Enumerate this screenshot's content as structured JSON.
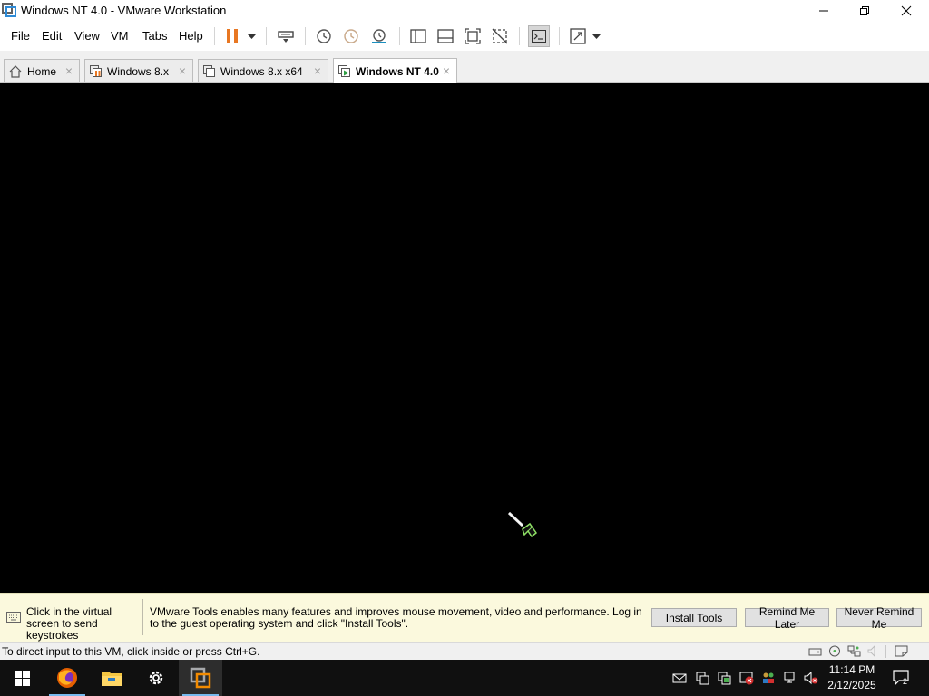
{
  "window": {
    "title": "Windows NT 4.0 - VMware Workstation"
  },
  "menu": [
    "File",
    "Edit",
    "View",
    "VM",
    "Tabs",
    "Help"
  ],
  "toolbar": {
    "icons": [
      "pause-icon",
      "dropdown-arrow-icon",
      "send-ctrl-alt-del-icon",
      "take-snapshot-icon",
      "revert-snapshot-icon",
      "snapshot-manager-icon",
      "show-library-icon",
      "show-thumbnail-bar-icon",
      "full-screen-icon",
      "unity-icon",
      "console-view-icon",
      "stretch-guest-icon",
      "dropdown-arrow-icon"
    ],
    "accent": "#e87722"
  },
  "tabs": [
    {
      "label": "Home",
      "active": false
    },
    {
      "label": "Windows 8.x",
      "active": false
    },
    {
      "label": "Windows 8.x x64",
      "active": false
    },
    {
      "label": "Windows NT 4.0",
      "active": true
    }
  ],
  "notification": {
    "hint": "Click in the virtual screen to send keystrokes",
    "message": "VMware Tools enables many features and improves mouse movement, video and performance. Log in to the guest operating system and click \"Install Tools\".",
    "buttons": {
      "install": "Install Tools",
      "remind_later": "Remind Me Later",
      "never_remind": "Never Remind Me"
    },
    "background": "#fbf9dd"
  },
  "status": {
    "text": "To direct input to this VM, click inside or press Ctrl+G.",
    "device_icons": [
      "hard-disk-icon",
      "cd-dvd-icon",
      "network-adapter-icon",
      "sound-card-icon",
      "message-log-icon"
    ]
  },
  "taskbar": {
    "apps": [
      "windows-start-icon",
      "firefox-icon",
      "file-explorer-icon",
      "settings-icon",
      "vmware-workstation-icon"
    ],
    "tray_icons": [
      "mail-icon",
      "vm-icon",
      "vm-icon",
      "security-warning-icon",
      "people-icon",
      "network-icon",
      "volume-muted-icon"
    ],
    "time": "11:14 PM",
    "date": "2/12/2025",
    "notification_count": "2"
  }
}
